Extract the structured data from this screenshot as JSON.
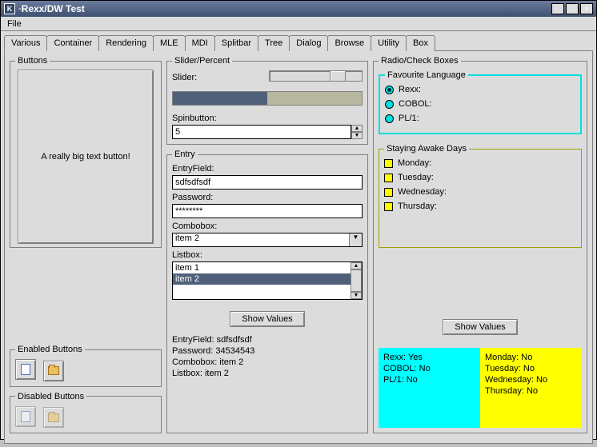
{
  "title": "Rexx/DW Test",
  "menu": {
    "file": "File"
  },
  "tabs": [
    "Various",
    "Container",
    "Rendering",
    "MLE",
    "MDI",
    "Splitbar",
    "Tree",
    "Dialog",
    "Browse",
    "Utility",
    "Box"
  ],
  "active_tab": 0,
  "buttons": {
    "legend": "Buttons",
    "bigtext": "A really big text button!",
    "enabled_legend": "Enabled Buttons",
    "disabled_legend": "Disabled Buttons"
  },
  "slider": {
    "legend": "Slider/Percent",
    "slider_label": "Slider:",
    "progress_pct": 50,
    "spin_label": "Spinbutton:",
    "spin_value": "5"
  },
  "entry": {
    "legend": "Entry",
    "entry_label": "EntryField:",
    "entry_value": "sdfsdfsdf",
    "password_label": "Password:",
    "password_masked": "********",
    "combo_label": "Combobox:",
    "combo_value": "item 2",
    "list_label": "Listbox:",
    "list_items": [
      "item 1",
      "item 2"
    ],
    "list_selected": 1,
    "show_btn": "Show Values",
    "summary": {
      "entry": "EntryField: sdfsdfsdf",
      "password": "Password: 34534543",
      "combo": "Combobox: item 2",
      "list": "Listbox: item 2"
    }
  },
  "radio": {
    "legend": "Radio/Check Boxes",
    "fav_legend": "Favourite Language",
    "fav": [
      {
        "label": "Rexx:",
        "selected": true
      },
      {
        "label": "COBOL:",
        "selected": false
      },
      {
        "label": "PL/1:",
        "selected": false
      }
    ],
    "days_legend": "Staying Awake Days",
    "days": [
      {
        "label": "Monday:"
      },
      {
        "label": "Tuesday:"
      },
      {
        "label": "Wednesday:"
      },
      {
        "label": "Thursday:"
      }
    ],
    "show_btn": "Show Values",
    "results_lang": [
      "Rexx: Yes",
      "COBOL: No",
      "PL/1: No"
    ],
    "results_days": [
      "Monday: No",
      "Tuesday: No",
      "Wednesday: No",
      "Thursday: No"
    ]
  }
}
